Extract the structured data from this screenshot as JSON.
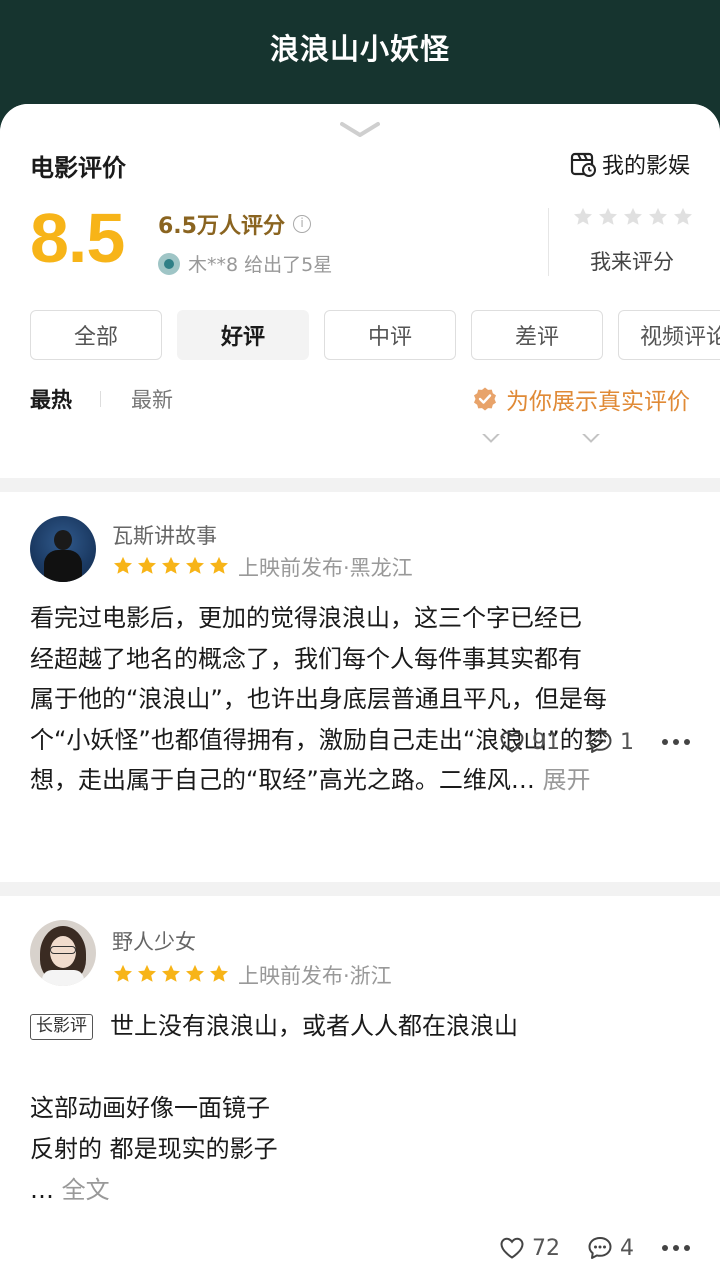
{
  "page_title": "浪浪山小妖怪",
  "header": {
    "section_title": "电影评价",
    "my_movies_label": "我的影娱",
    "score": "8.5",
    "rating_count": "6.5万人评分",
    "friend_rating": "木**8 给出了5星",
    "rate_me_label": "我来评分",
    "tabs": [
      {
        "label": "全部",
        "active": false
      },
      {
        "label": "好评",
        "active": true
      },
      {
        "label": "中评",
        "active": false
      },
      {
        "label": "差评",
        "active": false
      },
      {
        "label": "视频评论",
        "active": false
      }
    ],
    "sort_hot": "最热",
    "sort_new": "最新",
    "real_review_tip": "为你展示真实评价"
  },
  "reviews": [
    {
      "username": "瓦斯讲故事",
      "stars": 5,
      "meta": "上映前发布·黑龙江",
      "lines": [
        "看完过电影后，更加的觉得浪浪山，这三个字已经已",
        "经超越了地名的概念了，我们每个人每件事其实都有",
        "属于他的“浪浪山”，也许出身底层普通且平凡，但是每",
        "个“小妖怪”也都值得拥有，激励自己走出“浪浪山”的梦",
        "想，走出属于自己的“取经”高光之路。二维风…"
      ],
      "expand_label": "展开",
      "likes": "91",
      "comments": "1"
    },
    {
      "username": "野人少女",
      "stars": 5,
      "meta": "上映前发布·浙江",
      "tag": "长影评",
      "headline": "世上没有浪浪山，或者人人都在浪浪山",
      "line1": "这部动画好像一面镜子",
      "line2": "反射的 都是现实的影子",
      "line3": "… ",
      "fulltext_label": "全文",
      "likes": "72",
      "comments": "4"
    }
  ],
  "colors": {
    "topbar_bg": "#16342f",
    "score": "#f7b418",
    "star": "#f7b418",
    "tip": "#e08a36"
  }
}
